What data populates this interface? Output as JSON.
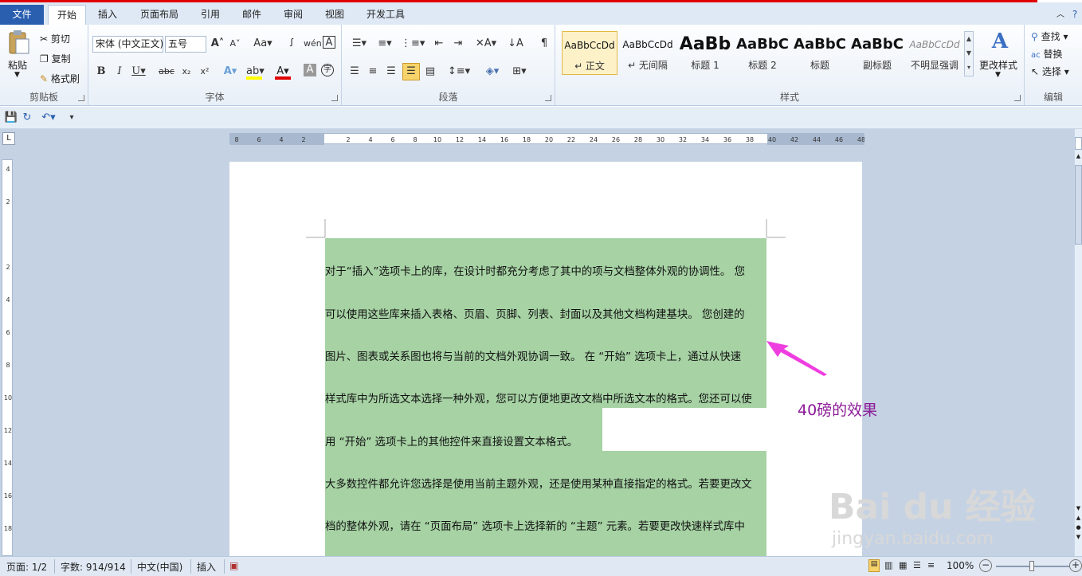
{
  "tabs": [
    "文件",
    "开始",
    "插入",
    "页面布局",
    "引用",
    "邮件",
    "审阅",
    "视图",
    "开发工具"
  ],
  "clipboard": {
    "paste": "粘贴",
    "cut": "剪切",
    "copy": "复制",
    "format_painter": "格式刷",
    "label": "剪贴板"
  },
  "font": {
    "name": "宋体 (中文正文)",
    "size": "五号",
    "label": "字体"
  },
  "paragraph": {
    "label": "段落"
  },
  "styles": {
    "items": [
      {
        "preview": "AaBbCcDd",
        "name": "↵ 正文"
      },
      {
        "preview": "AaBbCcDd",
        "name": "↵ 无间隔"
      },
      {
        "preview": "AaBb",
        "name": "标题 1"
      },
      {
        "preview": "AaBbC",
        "name": "标题 2"
      },
      {
        "preview": "AaBbC",
        "name": "标题"
      },
      {
        "preview": "AaBbC",
        "name": "副标题"
      },
      {
        "preview": "AaBbCcDd",
        "name": "不明显强调"
      }
    ],
    "change_styles": "更改样式",
    "label": "样式"
  },
  "editing": {
    "find": "查找",
    "replace": "替换",
    "select": "选择",
    "label": "编辑"
  },
  "hruler_ticks": [
    "8",
    "6",
    "4",
    "2",
    "",
    "2",
    "4",
    "6",
    "8",
    "10",
    "12",
    "14",
    "16",
    "18",
    "20",
    "22",
    "24",
    "26",
    "28",
    "30",
    "32",
    "34",
    "36",
    "38",
    "40",
    "42",
    "44",
    "46",
    "48"
  ],
  "vruler_ticks": [
    "4",
    "2",
    "",
    "2",
    "4",
    "6",
    "8",
    "10",
    "12",
    "14",
    "16",
    "18"
  ],
  "document": {
    "lines": [
      "对于“插入”选项卡上的库，在设计时都充分考虑了其中的项与文档整体外观的协调性。 您",
      "可以使用这些库来插入表格、页眉、页脚、列表、封面以及其他文档构建基块。 您创建的",
      "图片、图表或关系图也将与当前的文档外观协调一致。 在 “开始” 选项卡上，通过从快速",
      "样式库中为所选文本选择一种外观，您可以方便地更改文档中所选文本的格式。您还可以使",
      "用 “开始” 选项卡上的其他控件来直接设置文本格式。",
      "大多数控件都允许您选择是使用当前主题外观，还是使用某种直接指定的格式。若要更改文",
      "档的整体外观，请在 “页面布局” 选项卡上选择新的 “主题” 元素。若要更改快速样式库中"
    ],
    "highlight_color": "#a6d2a4"
  },
  "annotation": {
    "text": "40磅的效果",
    "color": "#8b1a96"
  },
  "status": {
    "page": "页面: 1/2",
    "words": "字数: 914/914",
    "language": "中文(中国)",
    "mode": "插入",
    "zoom": "100%"
  },
  "watermark": {
    "brand": "Bai du 经验",
    "url": "jingyan.baidu.com"
  }
}
